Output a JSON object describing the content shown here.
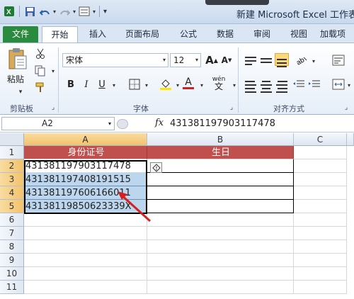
{
  "window": {
    "title": "新建 Microsoft Excel 工作表.x"
  },
  "tabs": [
    "文件",
    "开始",
    "插入",
    "页面布局",
    "公式",
    "数据",
    "审阅",
    "视图",
    "加载项"
  ],
  "ribbon": {
    "paste_label": "粘贴",
    "groups": {
      "clipboard": "剪贴板",
      "font": "字体",
      "alignment": "对齐方式"
    },
    "font_name": "宋体",
    "font_size": "12",
    "bold": "B",
    "italic": "I",
    "underline": "U",
    "grow_font": "A",
    "shrink_font": "A",
    "font_color_letter": "A",
    "wen": "wén"
  },
  "formula_bar": {
    "name_box": "A2",
    "fx": "fx",
    "content": "431381197903117478"
  },
  "grid": {
    "columns": [
      "A",
      "B",
      "C"
    ],
    "rows": [
      "1",
      "2",
      "3",
      "4",
      "5",
      "6",
      "7",
      "8",
      "9",
      "10",
      "11"
    ],
    "cells": {
      "A1": "身份证号",
      "B1": "生日",
      "A2": "431381197903117478",
      "A3": "431381197408191515",
      "A4": "431381197606166011",
      "A5": "43138119850623339X"
    }
  },
  "colors": {
    "header_fill": "#c0504d",
    "selection_fill": "#bcd6ee",
    "file_tab": "#2a8a3e",
    "arrow": "#d42020"
  }
}
